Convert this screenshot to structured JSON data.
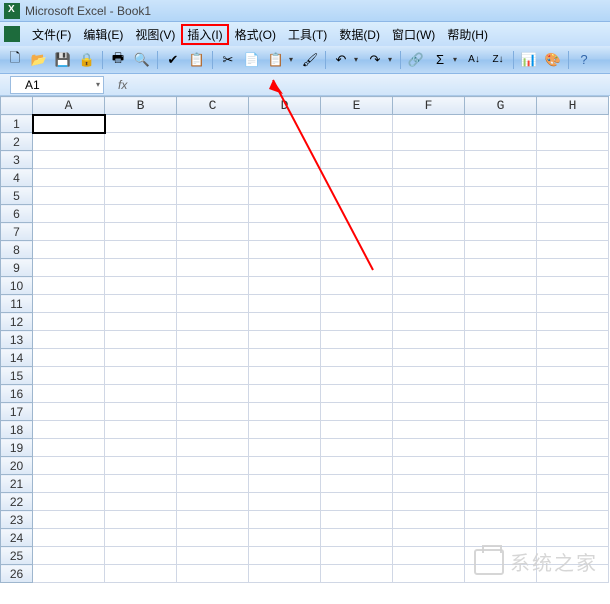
{
  "titlebar": {
    "text": "Microsoft Excel - Book1"
  },
  "menu": {
    "items": [
      {
        "label": "文件(F)"
      },
      {
        "label": "编辑(E)"
      },
      {
        "label": "视图(V)"
      },
      {
        "label": "插入(I)",
        "highlighted": true
      },
      {
        "label": "格式(O)"
      },
      {
        "label": "工具(T)"
      },
      {
        "label": "数据(D)"
      },
      {
        "label": "窗口(W)"
      },
      {
        "label": "帮助(H)"
      }
    ]
  },
  "toolbar": {
    "icons": [
      {
        "name": "new-icon",
        "glyph": "🗋"
      },
      {
        "name": "open-icon",
        "glyph": "📂"
      },
      {
        "name": "save-icon",
        "glyph": "💾"
      },
      {
        "name": "permissions-icon",
        "glyph": "🔒"
      },
      {
        "name": "print-icon",
        "glyph": "🖶"
      },
      {
        "name": "preview-icon",
        "glyph": "🔍"
      },
      {
        "name": "spellcheck-icon",
        "glyph": "✔"
      },
      {
        "name": "research-icon",
        "glyph": "📋"
      },
      {
        "name": "cut-icon",
        "glyph": "✂"
      },
      {
        "name": "copy-icon",
        "glyph": "📄"
      },
      {
        "name": "paste-icon",
        "glyph": "📋"
      },
      {
        "name": "format-painter-icon",
        "glyph": "🖌"
      },
      {
        "name": "undo-icon",
        "glyph": "↶"
      },
      {
        "name": "redo-icon",
        "glyph": "↷"
      },
      {
        "name": "hyperlink-icon",
        "glyph": "🔗"
      },
      {
        "name": "autosum-icon",
        "glyph": "Σ"
      },
      {
        "name": "sort-asc-icon",
        "glyph": "A↓"
      },
      {
        "name": "sort-desc-icon",
        "glyph": "Z↓"
      },
      {
        "name": "chart-icon",
        "glyph": "📊"
      },
      {
        "name": "drawing-icon",
        "glyph": "🎨"
      },
      {
        "name": "help-icon",
        "glyph": "?"
      }
    ]
  },
  "namebox": {
    "value": "A1"
  },
  "formula_bar": {
    "fx_label": "fx",
    "value": ""
  },
  "grid": {
    "columns": [
      "A",
      "B",
      "C",
      "D",
      "E",
      "F",
      "G",
      "H"
    ],
    "row_count": 26,
    "selected_cell": "A1",
    "selected_col": "A",
    "selected_row": 1
  },
  "watermark": {
    "text": "系统之家",
    "url": "系统之家"
  }
}
